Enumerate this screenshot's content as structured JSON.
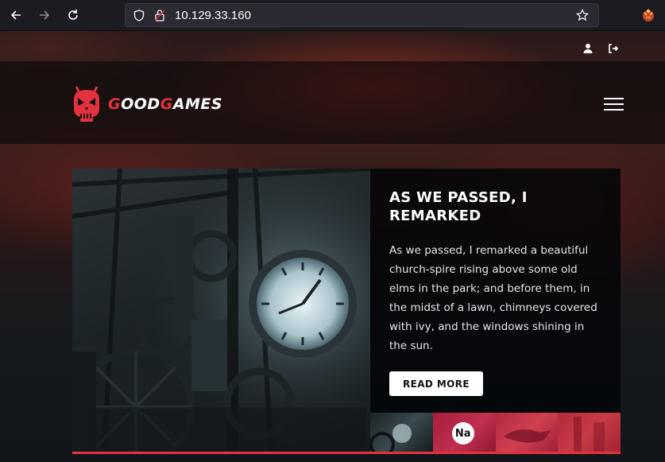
{
  "browser": {
    "url": "10.129.33.160"
  },
  "site": {
    "logo_prefix": "G",
    "logo_mid": "OOD",
    "logo_c": "G",
    "logo_suffix": "AMES"
  },
  "hero": {
    "title": "AS WE PASSED, I REMARKED",
    "text": "As we passed, I remarked a beautiful church-spire rising above some old elms in the park; and before them, in the midst of a lawn, chimneys covered with ivy, and the windows shining in the sun.",
    "button_label": "READ MORE",
    "thumb_badge": "Na"
  },
  "colors": {
    "accent": "#e2323f",
    "header_bg": "#0a080a",
    "panel_bg": "#040608"
  },
  "icons": [
    "back-arrow-icon",
    "forward-arrow-icon",
    "reload-icon",
    "shield-icon",
    "lock-icon",
    "star-icon",
    "extension-icon",
    "user-icon",
    "logout-icon",
    "hamburger-menu-icon"
  ]
}
